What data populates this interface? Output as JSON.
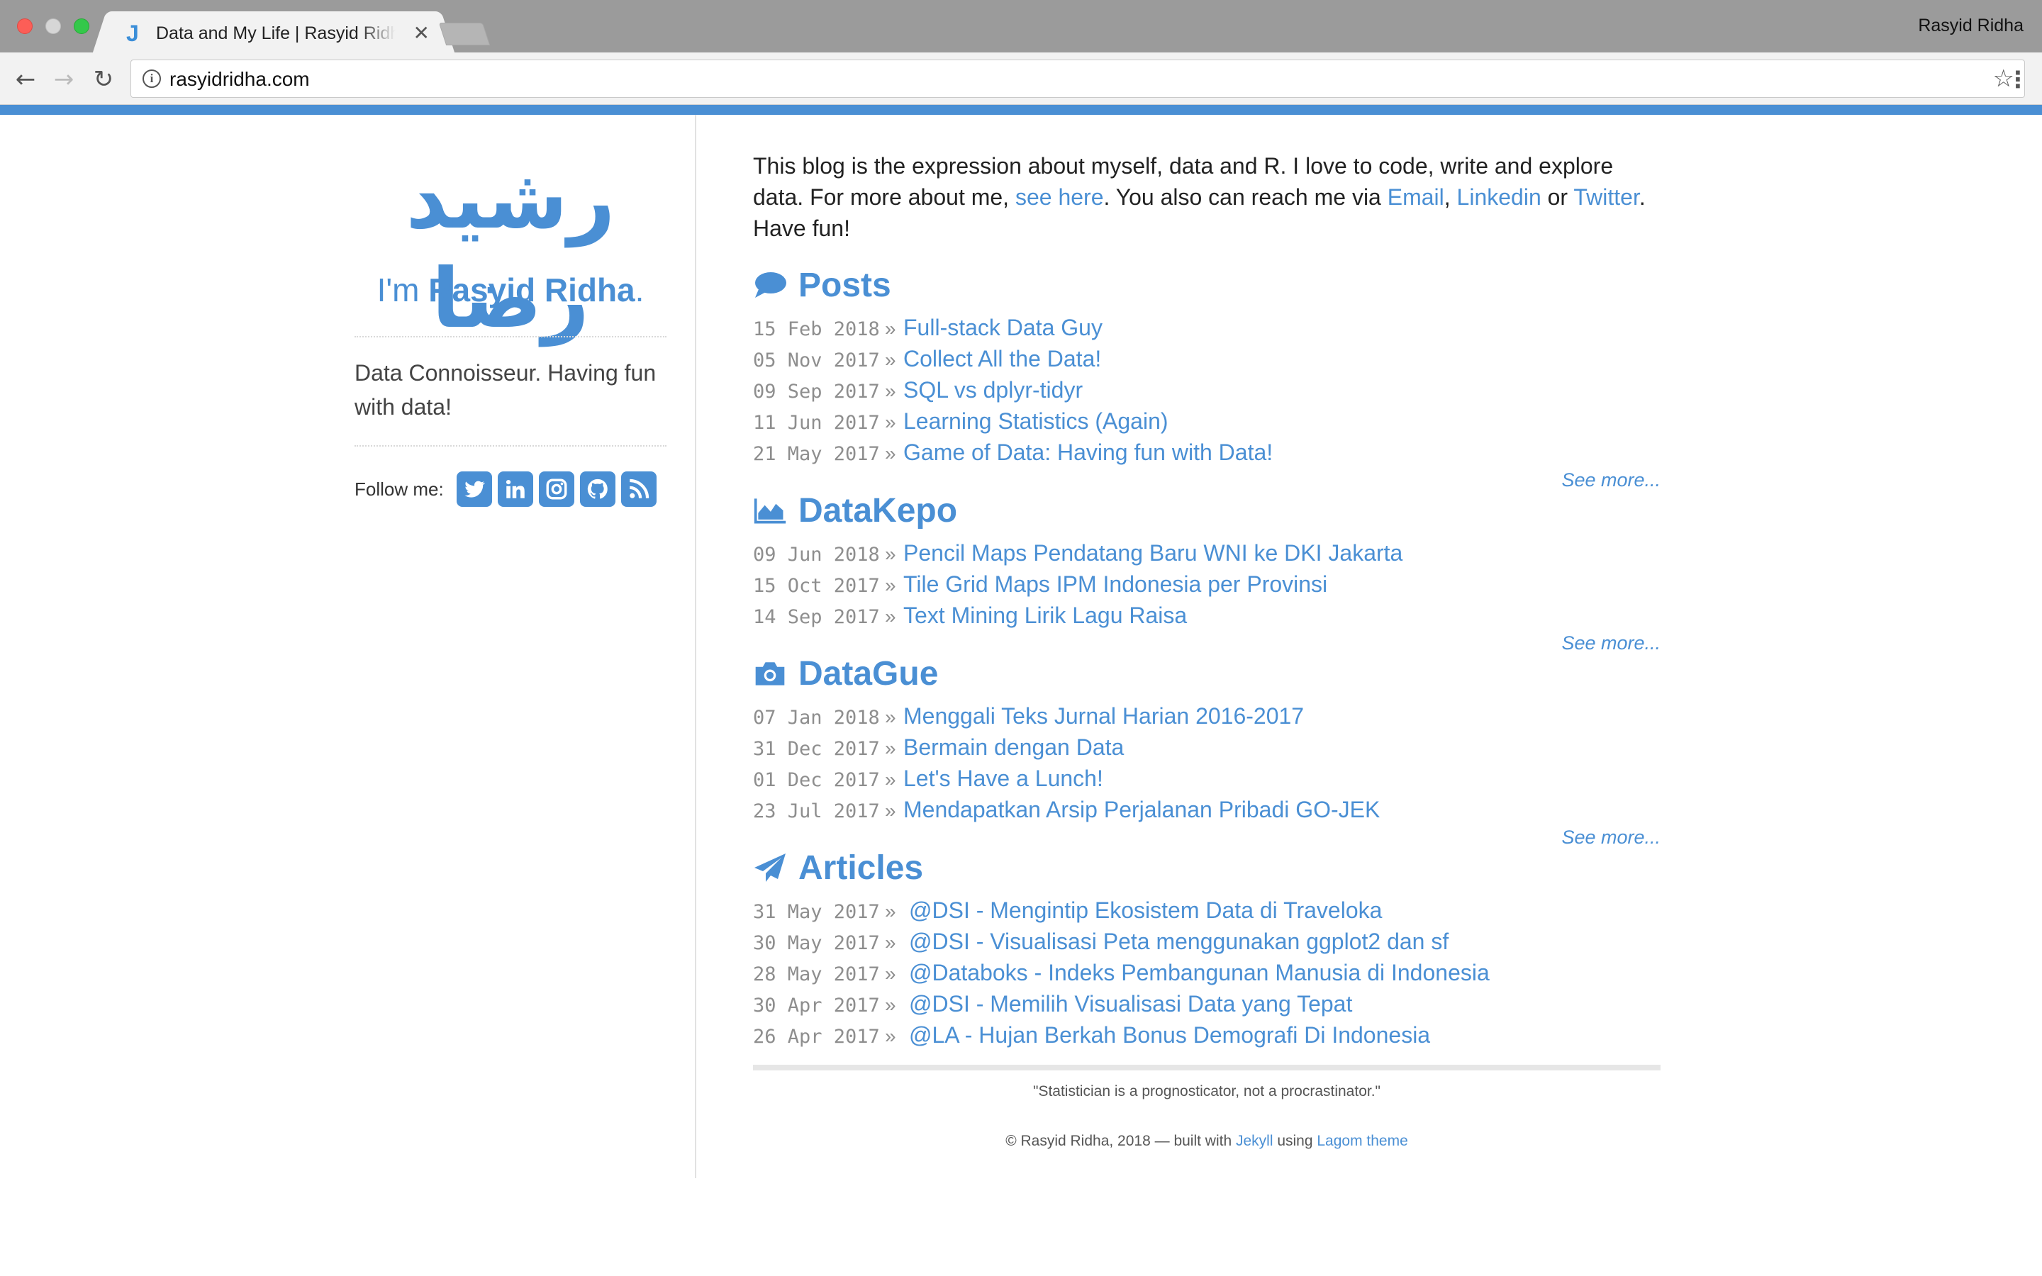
{
  "browser": {
    "tab_title": "Data and My Life | Rasyid Ridha",
    "tab_favicon": "J",
    "profile_name": "Rasyid Ridha",
    "url": "rasyidridha.com",
    "icons": [
      "back-arrow-icon",
      "forward-arrow-icon",
      "reload-icon",
      "info-icon",
      "star-icon",
      "kebab-menu-icon",
      "close-icon"
    ]
  },
  "sidebar": {
    "logo_text": "رشيد رضا",
    "intro_prefix": "I'm ",
    "intro_name": "Rasyid Ridha",
    "intro_suffix": ".",
    "tagline": "Data Connoisseur. Having fun with data!",
    "follow_label": "Follow me:",
    "social_icons": [
      "twitter-icon",
      "linkedin-icon",
      "instagram-icon",
      "github-icon",
      "rss-icon"
    ]
  },
  "blurb": {
    "t1": "This blog is the expression about myself, data and R. I love to code, write and explore data. For more about me, ",
    "link_see_here": "see here",
    "t2": ". You also can reach me via ",
    "link_email": "Email",
    "t3": ", ",
    "link_linkedin": "Linkedin",
    "t4": " or ",
    "link_twitter": "Twitter",
    "t5": ". Have fun!"
  },
  "posts": {
    "title": "Posts",
    "items": [
      {
        "date": "15 Feb 2018",
        "sep": "»",
        "title": "Full-stack Data Guy"
      },
      {
        "date": "05 Nov 2017",
        "sep": "»",
        "title": "Collect All the Data!"
      },
      {
        "date": "09 Sep 2017",
        "sep": "»",
        "title": "SQL vs dplyr-tidyr"
      },
      {
        "date": "11 Jun 2017",
        "sep": "»",
        "title": "Learning Statistics (Again)"
      },
      {
        "date": "21 May 2017",
        "sep": "»",
        "title": "Game of Data: Having fun with Data!"
      }
    ],
    "see_more": "See more..."
  },
  "datakepo": {
    "title": "DataKepo",
    "items": [
      {
        "date": "09 Jun 2018",
        "sep": "»",
        "title": "Pencil Maps Pendatang Baru WNI ke DKI Jakarta"
      },
      {
        "date": "15 Oct 2017",
        "sep": "»",
        "title": "Tile Grid Maps IPM Indonesia per Provinsi"
      },
      {
        "date": "14 Sep 2017",
        "sep": "»",
        "title": "Text Mining Lirik Lagu Raisa"
      }
    ],
    "see_more": "See more..."
  },
  "datague": {
    "title": "DataGue",
    "items": [
      {
        "date": "07 Jan 2018",
        "sep": "»",
        "title": "Menggali Teks Jurnal Harian 2016-2017"
      },
      {
        "date": "31 Dec 2017",
        "sep": "»",
        "title": "Bermain dengan Data"
      },
      {
        "date": "01 Dec 2017",
        "sep": "»",
        "title": "Let's Have a Lunch!"
      },
      {
        "date": "23 Jul 2017",
        "sep": "»",
        "title": "Mendapatkan Arsip Perjalanan Pribadi GO-JEK"
      }
    ],
    "see_more": "See more..."
  },
  "articles": {
    "title": "Articles",
    "items": [
      {
        "date": "31 May 2017",
        "sep": "»",
        "title": "@DSI - Mengintip Ekosistem Data di Traveloka"
      },
      {
        "date": "30 May 2017",
        "sep": "»",
        "title": "@DSI - Visualisasi Peta menggunakan ggplot2 dan sf"
      },
      {
        "date": "28 May 2017",
        "sep": "»",
        "title": "@Databoks - Indeks Pembangunan Manusia di Indonesia"
      },
      {
        "date": "30 Apr 2017",
        "sep": "»",
        "title": "@DSI - Memilih Visualisasi Data yang Tepat"
      },
      {
        "date": "26 Apr 2017",
        "sep": "»",
        "title": "@LA - Hujan Berkah Bonus Demografi Di Indonesia"
      }
    ]
  },
  "footer": {
    "quote": "\"Statistician is a prognosticator, not a procrastinator.\"",
    "copy_prefix": "© Rasyid Ridha, 2018 — built with ",
    "link_jekyll": "Jekyll",
    "copy_mid": " using ",
    "link_theme": "Lagom theme"
  },
  "colors": {
    "accent": "#4a8fd4",
    "date_gray": "#8e8e8e",
    "titlebar": "#9b9b9b",
    "toolbar": "#f2f2f2"
  }
}
